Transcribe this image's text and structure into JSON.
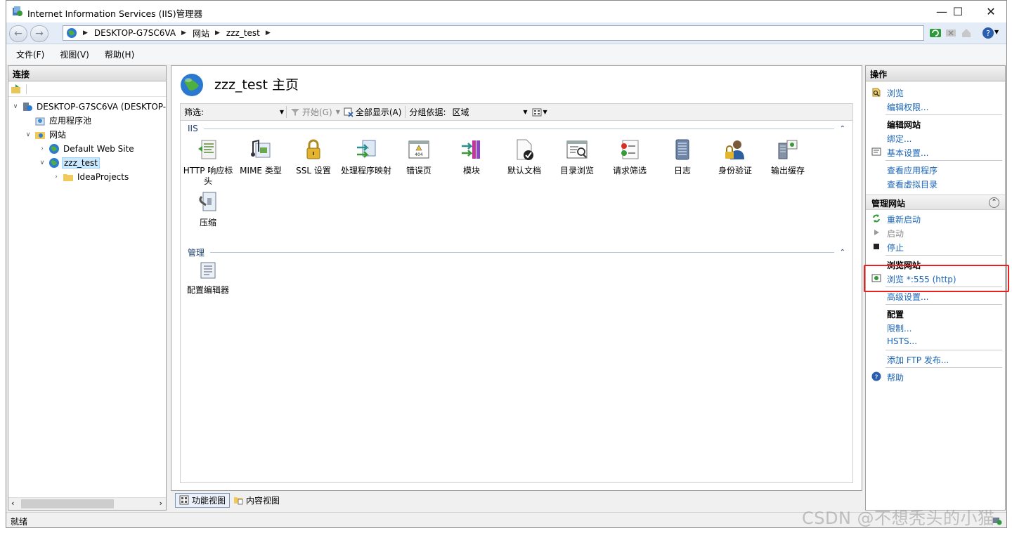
{
  "window": {
    "title": "Internet Information Services (IIS)管理器",
    "minimize": "—",
    "maximize": "☐",
    "close": "✕"
  },
  "address": {
    "crumbs": [
      "DESKTOP-G7SC6VA",
      "网站",
      "zzz_test"
    ],
    "back": "←",
    "forward": "→"
  },
  "menu": [
    "文件(F)",
    "视图(V)",
    "帮助(H)"
  ],
  "connections": {
    "title": "连接",
    "tree": [
      {
        "label": "DESKTOP-G7SC6VA (DESKTOP-",
        "icon": "server-icon"
      },
      {
        "label": "应用程序池",
        "icon": "app-pool-icon"
      },
      {
        "label": "网站",
        "icon": "sites-folder-icon"
      },
      {
        "label": "Default Web Site",
        "icon": "globe-icon"
      },
      {
        "label": "zzz_test",
        "icon": "globe-icon"
      },
      {
        "label": "IdeaProjects",
        "icon": "folder-icon"
      }
    ]
  },
  "main": {
    "title": "zzz_test 主页",
    "filter": {
      "label": "筛选:",
      "start": "开始(G)",
      "show_all": "全部显示(A)",
      "group_label": "分组依据:",
      "group_value": "区域"
    },
    "groups": [
      {
        "name": "IIS"
      },
      {
        "name": "管理"
      }
    ],
    "iis_features": [
      {
        "label": "HTTP 响应标头",
        "icon": "http-response-headers-icon"
      },
      {
        "label": "MIME 类型",
        "icon": "mime-types-icon"
      },
      {
        "label": "SSL 设置",
        "icon": "ssl-lock-icon"
      },
      {
        "label": "处理程序映射",
        "icon": "handler-mappings-icon"
      },
      {
        "label": "错误页",
        "icon": "error-pages-icon"
      },
      {
        "label": "模块",
        "icon": "modules-icon"
      },
      {
        "label": "默认文档",
        "icon": "default-document-icon"
      },
      {
        "label": "目录浏览",
        "icon": "directory-browsing-icon"
      },
      {
        "label": "请求筛选",
        "icon": "request-filtering-icon"
      },
      {
        "label": "日志",
        "icon": "logging-icon"
      },
      {
        "label": "身份验证",
        "icon": "authentication-icon"
      },
      {
        "label": "输出缓存",
        "icon": "output-caching-icon"
      },
      {
        "label": "压缩",
        "icon": "compression-icon"
      }
    ],
    "manage_features": [
      {
        "label": "配置编辑器",
        "icon": "configuration-editor-icon"
      }
    ]
  },
  "views": {
    "features": "功能视图",
    "content": "内容视图"
  },
  "actions": {
    "title": "操作",
    "browse": "浏览",
    "edit_permissions": "编辑权限...",
    "edit_site_head": "编辑网站",
    "bindings": "绑定...",
    "basic_settings": "基本设置...",
    "view_applications": "查看应用程序",
    "view_virtual_dirs": "查看虚拟目录",
    "manage_site_title": "管理网站",
    "restart": "重新启动",
    "start": "启动",
    "stop": "停止",
    "browse_site_head": "浏览网站",
    "browse_port": "浏览 *:555 (http)",
    "advanced_settings": "高级设置...",
    "config_head": "配置",
    "limits": "限制...",
    "hsts": "HSTS...",
    "add_ftp": "添加 FTP 发布...",
    "help": "帮助"
  },
  "status": {
    "text": "就绪"
  },
  "watermark": "CSDN @不想秃头的小猫",
  "colors": {
    "link": "#1a64b8",
    "highlight_box": "#e8201e",
    "selected_bg": "#cce8ff"
  }
}
